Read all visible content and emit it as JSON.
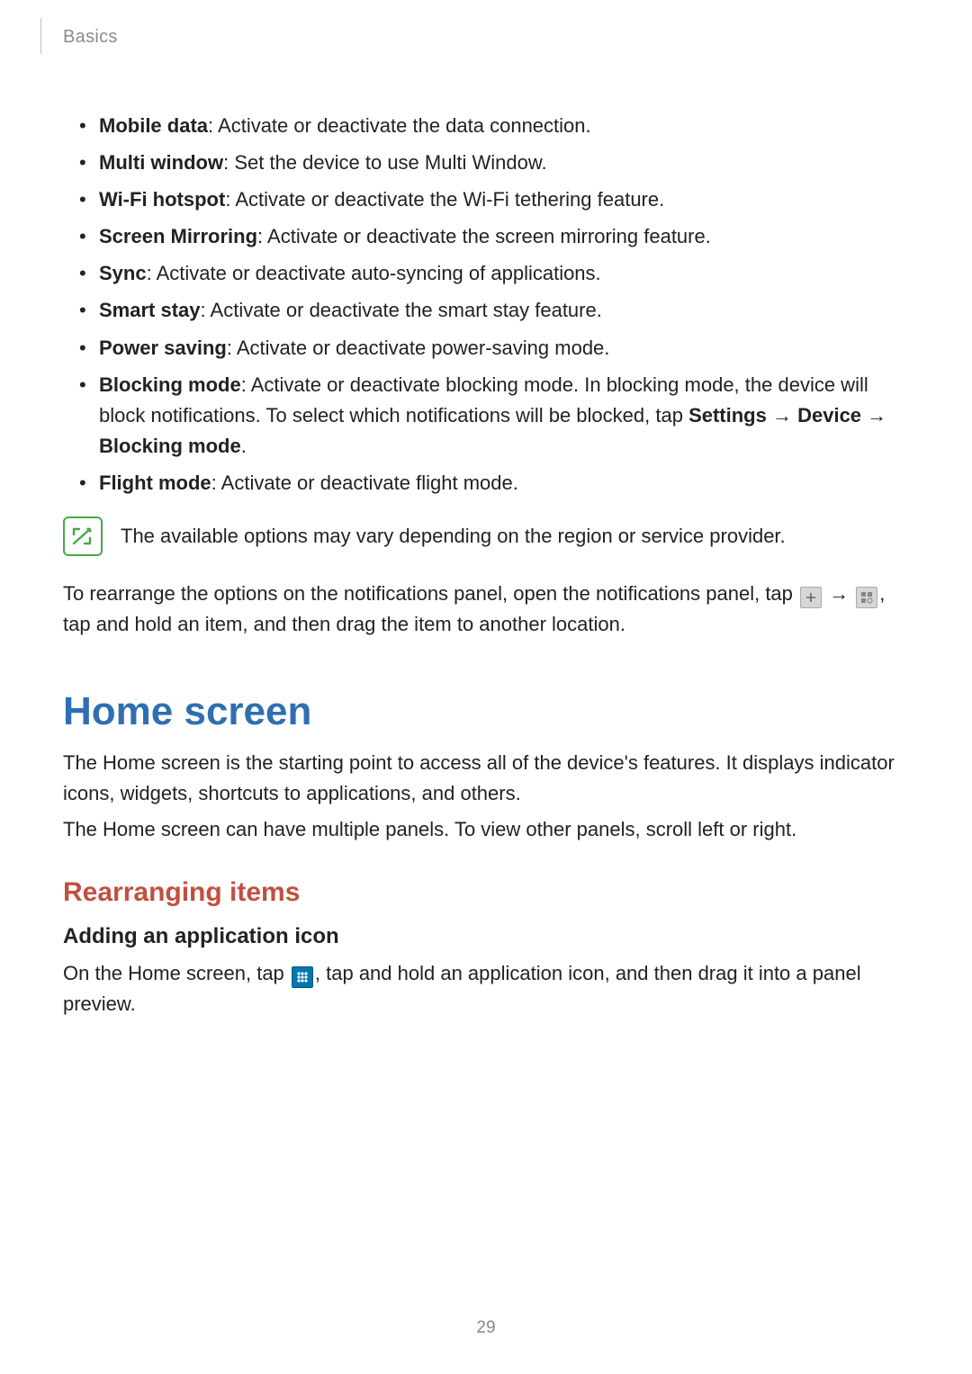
{
  "header": {
    "chapter": "Basics"
  },
  "features": [
    {
      "term": "Mobile data",
      "desc": ": Activate or deactivate the data connection."
    },
    {
      "term": "Multi window",
      "desc": ": Set the device to use Multi Window."
    },
    {
      "term": "Wi-Fi hotspot",
      "desc": ": Activate or deactivate the Wi-Fi tethering feature."
    },
    {
      "term": "Screen Mirroring",
      "desc": ": Activate or deactivate the screen mirroring feature."
    },
    {
      "term": "Sync",
      "desc": ": Activate or deactivate auto-syncing of applications."
    },
    {
      "term": "Smart stay",
      "desc": ": Activate or deactivate the smart stay feature."
    },
    {
      "term": "Power saving",
      "desc": ": Activate or deactivate power-saving mode."
    }
  ],
  "blocking": {
    "term": "Blocking mode",
    "desc1": ": Activate or deactivate blocking mode. In blocking mode, the device will block notifications. To select which notifications will be blocked, tap ",
    "settings": "Settings",
    "arrow1": " → ",
    "device": "Device",
    "arrow2": " → ",
    "blocking_mode": "Blocking mode",
    "period": "."
  },
  "flight": {
    "term": "Flight mode",
    "desc": ": Activate or deactivate flight mode."
  },
  "note": {
    "text": "The available options may vary depending on the region or service provider."
  },
  "rearrange": {
    "p1a": "To rearrange the options on the notifications panel, open the notifications panel, tap ",
    "arrow": " → ",
    "p1b": ", tap and hold an item, and then drag the item to another location."
  },
  "home_screen": {
    "title": "Home screen",
    "p1": "The Home screen is the starting point to access all of the device's features. It displays indicator icons, widgets, shortcuts to applications, and others.",
    "p2": "The Home screen can have multiple panels. To view other panels, scroll left or right."
  },
  "rearranging_items": {
    "title": "Rearranging items",
    "adding_icon_title": "Adding an application icon",
    "adding_icon_p_a": "On the Home screen, tap ",
    "adding_icon_p_b": ", tap and hold an application icon, and then drag it into a panel preview."
  },
  "page_number": "29"
}
